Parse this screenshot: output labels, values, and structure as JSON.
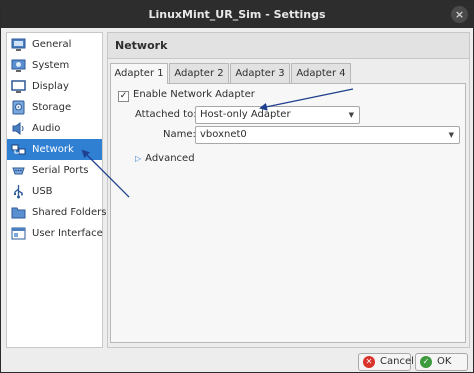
{
  "window": {
    "title": "LinuxMint_UR_Sim - Settings",
    "close_glyph": "×"
  },
  "sidebar": {
    "items": [
      {
        "label": "General",
        "icon": "general-icon"
      },
      {
        "label": "System",
        "icon": "system-icon"
      },
      {
        "label": "Display",
        "icon": "display-icon"
      },
      {
        "label": "Storage",
        "icon": "storage-icon"
      },
      {
        "label": "Audio",
        "icon": "audio-icon"
      },
      {
        "label": "Network",
        "icon": "network-icon",
        "selected": true
      },
      {
        "label": "Serial Ports",
        "icon": "serial-ports-icon"
      },
      {
        "label": "USB",
        "icon": "usb-icon"
      },
      {
        "label": "Shared Folders",
        "icon": "shared-folders-icon"
      },
      {
        "label": "User Interface",
        "icon": "user-interface-icon"
      }
    ]
  },
  "main": {
    "section_title": "Network",
    "tabs": [
      {
        "label": "Adapter 1",
        "active": true
      },
      {
        "label": "Adapter 2"
      },
      {
        "label": "Adapter 3"
      },
      {
        "label": "Adapter 4"
      }
    ],
    "enable_adapter": {
      "label": "Enable Network Adapter",
      "checked": true,
      "check_glyph": "✓"
    },
    "attached_to": {
      "label": "Attached to:",
      "value": "Host-only Adapter"
    },
    "name": {
      "label": "Name:",
      "value": "vboxnet0"
    },
    "advanced": {
      "label": "Advanced",
      "icon": "expand-triangle-icon"
    }
  },
  "buttons": {
    "cancel": {
      "label": "Cancel",
      "icon": "cancel-icon",
      "glyph": "✕"
    },
    "ok": {
      "label": "OK",
      "icon": "ok-icon",
      "glyph": "✓"
    }
  },
  "colors": {
    "selection": "#2f7fd2",
    "annotation_arrow": "#1f3f8f",
    "titlebar": "#2d2d2d",
    "cancel_icon": "#d9342b",
    "ok_icon": "#3d9a3d"
  }
}
